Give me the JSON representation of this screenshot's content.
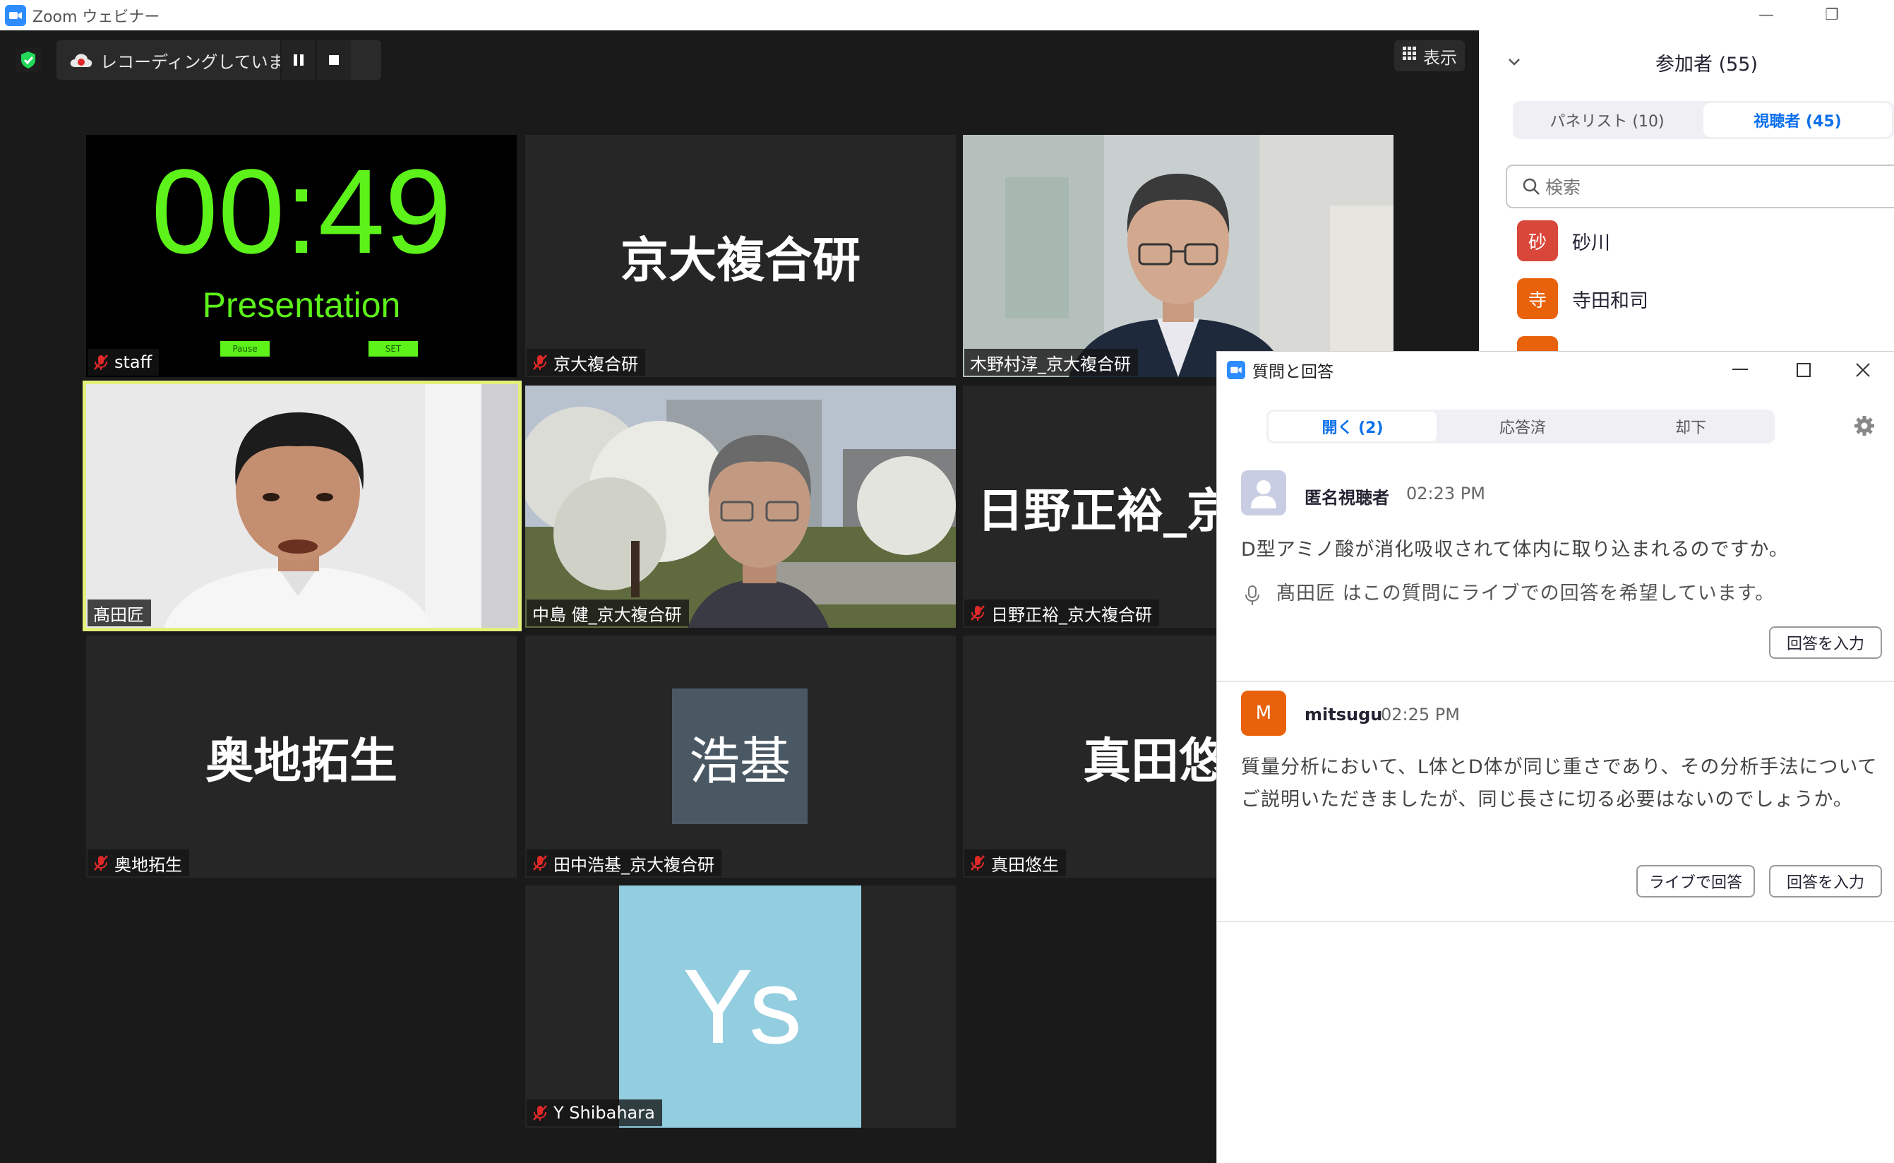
{
  "window": {
    "title": "Zoom ウェビナー",
    "minimize": "—",
    "restore": "❐"
  },
  "recording": {
    "status": "レコーディングしています..."
  },
  "view_button": {
    "label": "表示"
  },
  "tiles": [
    {
      "label": "staff",
      "muted": true,
      "timer": "00:49",
      "timer_caption": "Presentation",
      "btn1": "Pause",
      "btn2": "SET"
    },
    {
      "label": "京大複合研",
      "muted": true,
      "display_name": "京大複合研"
    },
    {
      "label": "木野村淳_京大複合研",
      "muted": false
    },
    {
      "label": "髙田匠",
      "muted": false,
      "active_speaker": true
    },
    {
      "label": "中島 健_京大複合研",
      "muted": false
    },
    {
      "label": "日野正裕_京大複合研",
      "muted": true,
      "display_name": "日野正裕_京大複合研"
    },
    {
      "label": "奥地拓生",
      "muted": true,
      "display_name": "奥地拓生"
    },
    {
      "label": "田中浩基_京大複合研",
      "muted": true,
      "avatar_text": "浩基"
    },
    {
      "label": "真田悠生",
      "muted": true,
      "display_name": "真田悠生"
    },
    {
      "label": "Y Shibahara",
      "muted": true,
      "avatar_text": "Ys"
    }
  ],
  "participants": {
    "title": "参加者 (55)",
    "tab_panelists": "パネリスト (10)",
    "tab_attendees": "視聴者 (45)",
    "search_placeholder": "検索",
    "list": [
      {
        "initial": "砂",
        "name": "砂川",
        "color": "#d9473a"
      },
      {
        "initial": "寺",
        "name": "寺田和司",
        "color": "#e8620c"
      }
    ]
  },
  "qa": {
    "title": "質問と回答",
    "tabs": [
      "開く (2)",
      "応答済",
      "却下"
    ],
    "questions": [
      {
        "name": "匿名視聴者",
        "time": "02:23 PM",
        "text": "D型アミノ酸が消化吸収されて体内に取り込まれるのですか。",
        "live_request": "髙田匠 はこの質問にライブでの回答を希望しています。",
        "answer_btn": "回答を入力"
      },
      {
        "initial": "M",
        "name": "mitsugu",
        "time": "02:25 PM",
        "text_line1": "質量分析において、L体とD体が同じ重さであり、その分析手法について",
        "text_line2": "ご説明いただきましたが、同じ長さに切る必要はないのでしょうか。",
        "live_btn": "ライブで回答",
        "answer_btn": "回答を入力"
      }
    ]
  },
  "colors": {
    "accent": "#0e71eb",
    "timer_green": "#5cf21a",
    "active_border": "#e3f07a",
    "avatar_slate": "#4a5864",
    "avatar_lightblue": "#93cde0",
    "avatar_orange": "#e8620c"
  }
}
